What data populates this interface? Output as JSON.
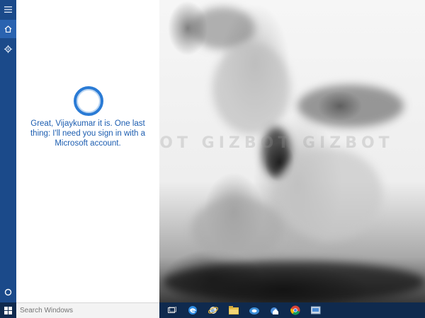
{
  "cortana": {
    "message": "Great, Vijaykumar it is. One last thing: I'll need you sign in with a Microsoft account."
  },
  "rail": {
    "items": [
      {
        "icon": "hamburger-menu-icon"
      },
      {
        "icon": "home-icon"
      },
      {
        "icon": "settings-gear-icon"
      },
      {
        "icon": "cortana-circle-icon"
      }
    ]
  },
  "taskbar": {
    "search_placeholder": "Search Windows",
    "icons": [
      "task-view-icon",
      "edge-icon",
      "internet-explorer-icon",
      "file-explorer-icon",
      "store-icon",
      "mail-icon",
      "chrome-icon",
      "app-icon"
    ]
  },
  "watermark": "GIZBOT GIZBOT GIZBOT GIZBOT",
  "colors": {
    "rail": "#1b4a8a",
    "rail_active": "#2a63b0",
    "cortana_blue": "#1c5db0",
    "taskbar": "#0f2a4e"
  }
}
